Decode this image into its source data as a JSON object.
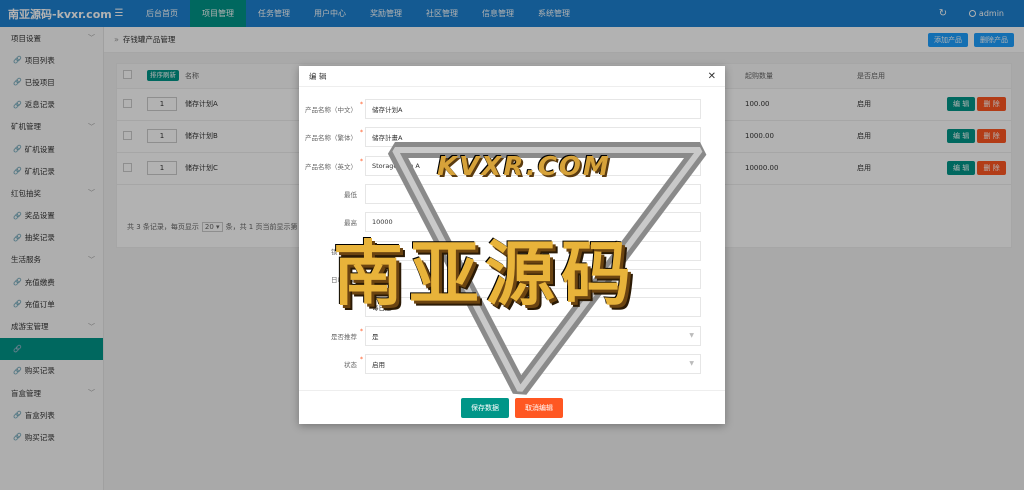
{
  "header": {
    "logo": "南亚源码-kvxr.com",
    "nav": [
      "后台首页",
      "项目管理",
      "任务管理",
      "用户中心",
      "奖励管理",
      "社区管理",
      "信息管理",
      "系统管理"
    ],
    "active_nav": 1,
    "user": "admin"
  },
  "sidebar": {
    "items": [
      {
        "label": "项目设置",
        "type": "group"
      },
      {
        "label": "项目列表",
        "type": "child"
      },
      {
        "label": "已投项目",
        "type": "child"
      },
      {
        "label": "返息记录",
        "type": "child"
      },
      {
        "label": "矿机管理",
        "type": "group"
      },
      {
        "label": "矿机设置",
        "type": "child"
      },
      {
        "label": "矿机记录",
        "type": "child"
      },
      {
        "label": "红包抽奖",
        "type": "group"
      },
      {
        "label": "奖品设置",
        "type": "child"
      },
      {
        "label": "抽奖记录",
        "type": "child"
      },
      {
        "label": "生活服务",
        "type": "group"
      },
      {
        "label": "充值缴费",
        "type": "child"
      },
      {
        "label": "充值订单",
        "type": "child"
      },
      {
        "label": "成游宝管理",
        "type": "group"
      },
      {
        "label": "",
        "type": "child",
        "active": true
      },
      {
        "label": "购买记录",
        "type": "child"
      },
      {
        "label": "盲盒管理",
        "type": "group"
      },
      {
        "label": "盲盒列表",
        "type": "child"
      },
      {
        "label": "购买记录",
        "type": "child"
      }
    ]
  },
  "page": {
    "breadcrumb": "存钱罐产品管理",
    "add_button": "添加产品",
    "delete_button": "删除产品",
    "table": {
      "sort_button": "排序刷新",
      "headers": {
        "name": "名称",
        "min_amount": "起购数量",
        "enabled": "是否启用"
      },
      "rows": [
        {
          "sort": "1",
          "name": "储存计划A",
          "min_amount": "100.00",
          "enabled": "启用"
        },
        {
          "sort": "1",
          "name": "储存计划B",
          "min_amount": "1000.00",
          "enabled": "启用"
        },
        {
          "sort": "1",
          "name": "储存计划C",
          "min_amount": "10000.00",
          "enabled": "启用"
        }
      ],
      "edit_label": "编 辑",
      "delete_label": "删 除"
    },
    "pager": {
      "prefix": "共 3 条记录，每页显示",
      "page_size": "20",
      "suffix": "条，共 1 页当前显示第 1 页"
    }
  },
  "modal": {
    "title": "编 辑",
    "fields": [
      {
        "label": "产品名称（中文）",
        "required": true,
        "value": "储存计划A"
      },
      {
        "label": "产品名称（繁体）",
        "required": true,
        "value": "储存計畫A"
      },
      {
        "label": "产品名称（英文）",
        "required": true,
        "value": "Storage Plan A"
      },
      {
        "label": "最低",
        "required": false,
        "value": ""
      },
      {
        "label": "最高",
        "required": false,
        "value": "10000"
      },
      {
        "label": "锁仓日期",
        "required": false,
        "value": ""
      },
      {
        "label": "日收益率",
        "required": false,
        "value": "0.13"
      },
      {
        "label": "",
        "required": false,
        "value": "每日返"
      },
      {
        "label": "是否推荐",
        "required": true,
        "value": "是",
        "select": true
      },
      {
        "label": "状态",
        "required": true,
        "value": "启用",
        "select": true
      }
    ],
    "save_button": "保存数据",
    "cancel_button": "取消编辑"
  },
  "watermark": {
    "site": "KVXR.COM",
    "brand": "南亚源码"
  },
  "colors": {
    "header_blue": "#1e82d1",
    "teal": "#009688",
    "orange": "#ff5722",
    "blue_button": "#1e9fff"
  }
}
